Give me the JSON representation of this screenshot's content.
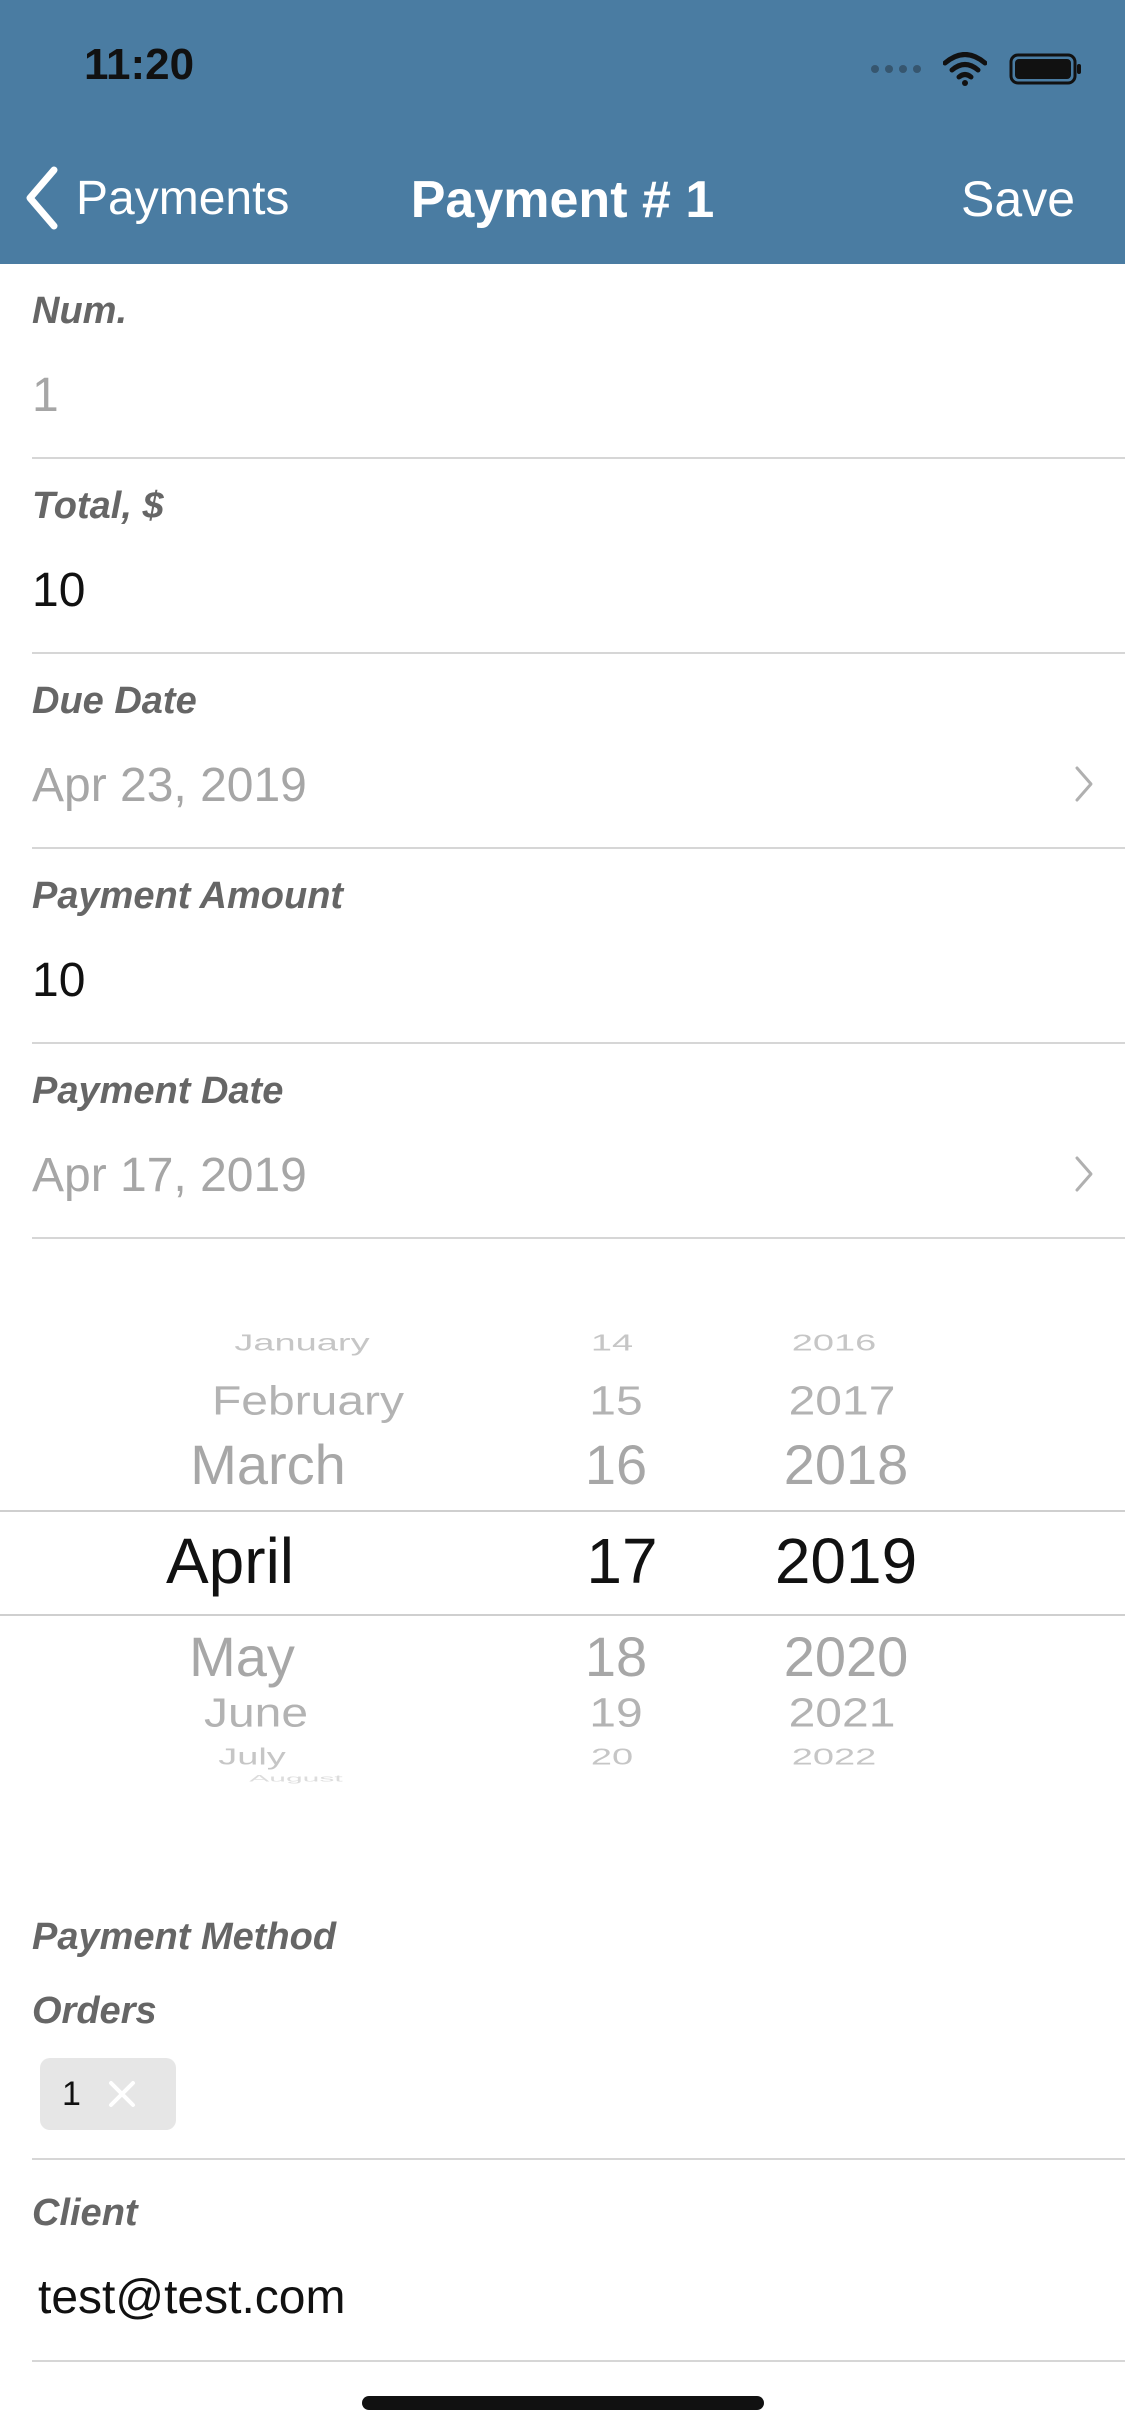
{
  "status_bar": {
    "time": "11:20"
  },
  "nav": {
    "back_label": "Payments",
    "title": "Payment # 1",
    "save_label": "Save"
  },
  "fields": {
    "num": {
      "label": "Num.",
      "value": "1"
    },
    "total": {
      "label": "Total, $",
      "value": "10"
    },
    "due_date": {
      "label": "Due Date",
      "value": "Apr 23, 2019"
    },
    "payment_amount": {
      "label": "Payment Amount",
      "value": "10"
    },
    "payment_date": {
      "label": "Payment Date",
      "value": "Apr 17, 2019"
    }
  },
  "picker": {
    "months": [
      "January",
      "February",
      "March",
      "April",
      "May",
      "June",
      "July",
      "August"
    ],
    "days": [
      "14",
      "15",
      "16",
      "17",
      "18",
      "19",
      "20"
    ],
    "years": [
      "2016",
      "2017",
      "2018",
      "2019",
      "2020",
      "2021",
      "2022"
    ],
    "selected": {
      "month": "April",
      "day": "17",
      "year": "2019"
    }
  },
  "payment_method": {
    "label": "Payment Method"
  },
  "orders": {
    "label": "Orders",
    "chips": [
      {
        "text": "1"
      }
    ]
  },
  "client": {
    "label": "Client",
    "value": "test@test.com"
  },
  "colors": {
    "header_bg": "#4a7ca2",
    "header_text": "#ffffff"
  },
  "icons": [
    "chevron-left-icon",
    "chevron-right-icon",
    "wifi-icon",
    "battery-icon",
    "signal-icon",
    "close-icon"
  ]
}
